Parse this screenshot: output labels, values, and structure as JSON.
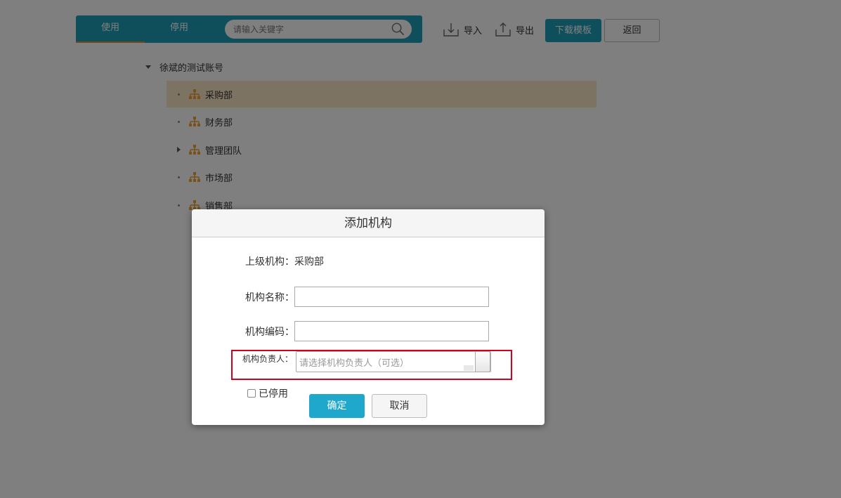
{
  "toolbar": {
    "tab_active": "使用",
    "tab_inactive": "停用",
    "search_placeholder": "请输入关键字",
    "import_label": "导入",
    "export_label": "导出",
    "download_template_label": "下载模板",
    "back_label": "返回",
    "colors": {
      "primary": "#1f9fb9",
      "tab_underline": "#e28a3b"
    }
  },
  "tree": {
    "root_label": "徐斌的测试账号",
    "nodes": [
      {
        "label": "采购部",
        "selected": true,
        "has_children": false
      },
      {
        "label": "财务部",
        "selected": false,
        "has_children": false
      },
      {
        "label": "管理团队",
        "selected": false,
        "has_children": true
      },
      {
        "label": "市场部",
        "selected": false,
        "has_children": false
      },
      {
        "label": "销售部",
        "selected": false,
        "has_children": false
      }
    ],
    "icon": "org-chart-icon",
    "icon_color": "#f0a030",
    "selected_color": "#fbe7c7"
  },
  "modal": {
    "title": "添加机构",
    "parent_label": "上级机构：",
    "parent_value": "采购部",
    "name_label": "机构名称：",
    "name_value": "",
    "code_label": "机构编码：",
    "code_value": "",
    "head_label": "机构负责人：",
    "head_placeholder": "请选择机构负责人（可选）",
    "disabled_label": "已停用",
    "disabled_checked": false,
    "ok_label": "确定",
    "cancel_label": "取消",
    "highlight_color": "#d0021b",
    "ok_color": "#1fa8cb"
  }
}
